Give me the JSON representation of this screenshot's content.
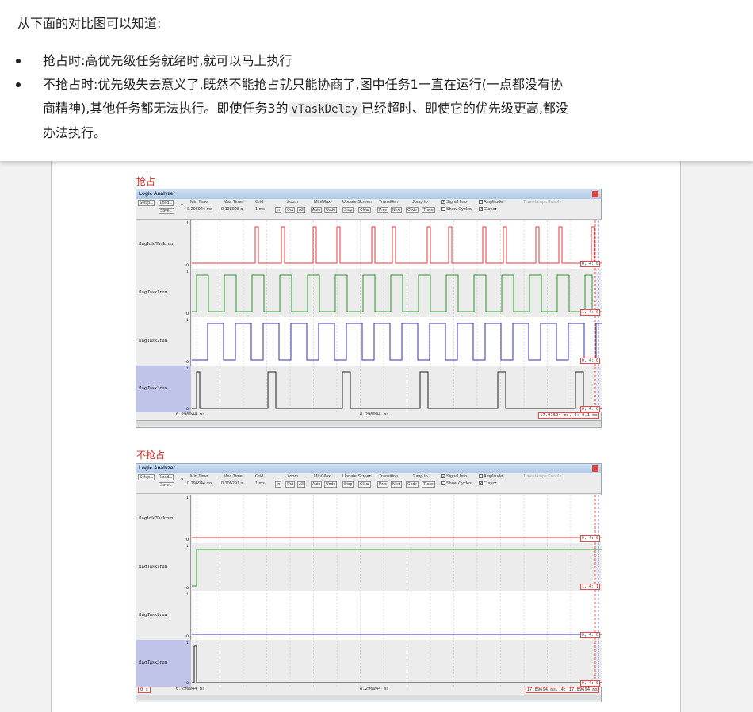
{
  "intro": "从下面的对比图可以知道:",
  "bullets": [
    {
      "text": "抢占时:高优先级任务就绪时,就可以马上执行"
    },
    {
      "line1": "不抢占时:优先级失去意义了,既然不能抢占就只能协商了,图中任务1一直在运行(一点都没有协",
      "line2_pre": "商精神),其他任务都无法执行。即使任务3的",
      "code": "vTaskDelay",
      "line2_post": "已经超时、即使它的优先级更高,都没",
      "line3": "办法执行。"
    }
  ],
  "figures": [
    {
      "caption": "抢占",
      "window_title": "Logic Analyzer",
      "min_time": "0.296944 ms",
      "max_time": "0.138098 s",
      "grid": "1 ms",
      "cursor_left": "0.296944 ms",
      "cursor_mid": "8.296944 ms",
      "cursor_right": "17.91694 ms,  4: 0,1 ms",
      "lane_values": [
        "0,  4: 0",
        "1,  4: 0",
        "0,  4: 0",
        "0,  4: 0"
      ]
    },
    {
      "caption": "不抢占",
      "window_title": "Logic Analyzer",
      "min_time": "0.296944 ms",
      "max_time": "0.105291 s",
      "grid": "1 ms",
      "cursor_left": "0.296944 ms",
      "cursor_mid": "8.296944 ms",
      "cursor_right": "17.89694 ms,  4: 17.89694 ms",
      "left_value": "0 s",
      "lane_values": [
        "0,  4: 0",
        "1,  4: 1",
        "0,  4: 0",
        "0,  4: 0"
      ]
    }
  ],
  "toolbar": {
    "setup": "Setup...",
    "load": "Load...",
    "save": "Save...",
    "help": "?",
    "min_time_label": "Min Time",
    "max_time_label": "Max Time",
    "grid_label": "Grid",
    "zoom_label": "Zoom",
    "zoom_in": "In",
    "zoom_out": "Out",
    "zoom_all": "All",
    "minmax_label": "Min/Max",
    "auto": "Auto",
    "undo": "Undo",
    "update_label": "Update Screen",
    "stop": "Stop",
    "clear": "Clear",
    "transition_label": "Transition",
    "prev": "Prev",
    "next": "Next",
    "jump_label": "Jump to",
    "code": "Code",
    "trace": "Trace",
    "signal_info": "Signal Info",
    "show_cycles": "Show Cycles",
    "amplitude": "Amplitude",
    "cursor": "Cursor",
    "timestamps": "Timestamps Enable"
  },
  "signals": [
    {
      "name": "flagIdleTaskrun",
      "color": "#e8383b"
    },
    {
      "name": "flagTask1run",
      "color": "#2a9a2a"
    },
    {
      "name": "flagTask2run",
      "color": "#3030b0"
    },
    {
      "name": "flagTask3run",
      "color": "#202020"
    }
  ],
  "lane_high": "1",
  "lane_low": "0"
}
